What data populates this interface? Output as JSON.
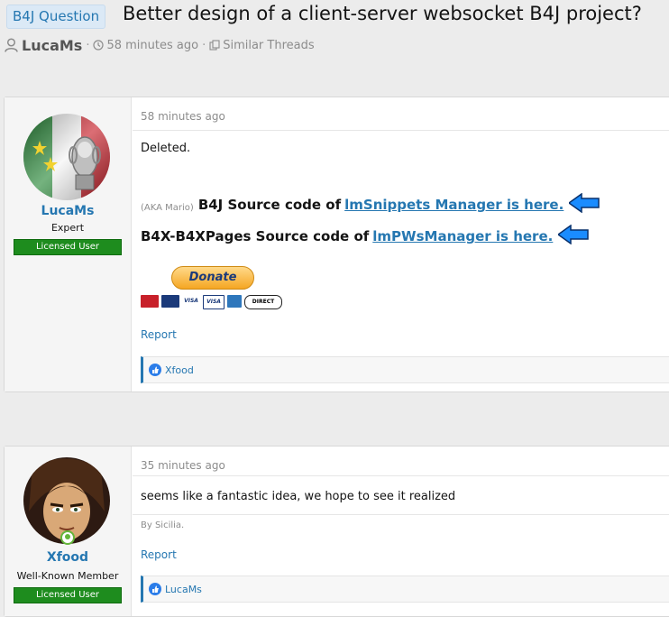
{
  "thread": {
    "prefix": "B4J Question",
    "title": "Better design of a client-server websocket B4J project?",
    "author": "LucaMs",
    "time_ago": "58 minutes ago",
    "similar_threads": "Similar Threads"
  },
  "posts": [
    {
      "username": "LucaMs",
      "user_title": "Expert",
      "badge": "Licensed User",
      "date": "58 minutes ago",
      "body": "Deleted.",
      "signature": {
        "aka": "(AKA Mario)",
        "line1_text": "B4J Source code of",
        "line1_link": "lmSnippets Manager is here.",
        "line2_text": "B4X-B4XPages Source code of",
        "line2_link": "lmPWsManager is here.",
        "donate_label": "Donate",
        "cards": [
          "MasterCard",
          "Maestro",
          "VISA",
          "VISA",
          "AMEX",
          "DIRECT Debit"
        ]
      },
      "report_label": "Report",
      "reaction_by": "Xfood"
    },
    {
      "username": "Xfood",
      "user_title": "Well-Known Member",
      "badge": "Licensed User",
      "date": "35 minutes ago",
      "body": "seems like a fantastic idea, we hope to see it realized",
      "signature_by": "By Sicilia.",
      "report_label": "Report",
      "reaction_by": "LucaMs"
    }
  ],
  "colors": {
    "link": "#2577b1",
    "licensed_badge": "#1e8c1e",
    "online": "#63b53a",
    "prefix_bg": "#dbe9f6"
  },
  "icons": [
    "user-icon",
    "clock-icon",
    "similar-threads-icon",
    "blue-arrow-icon",
    "like-icon",
    "online-indicator-icon"
  ]
}
